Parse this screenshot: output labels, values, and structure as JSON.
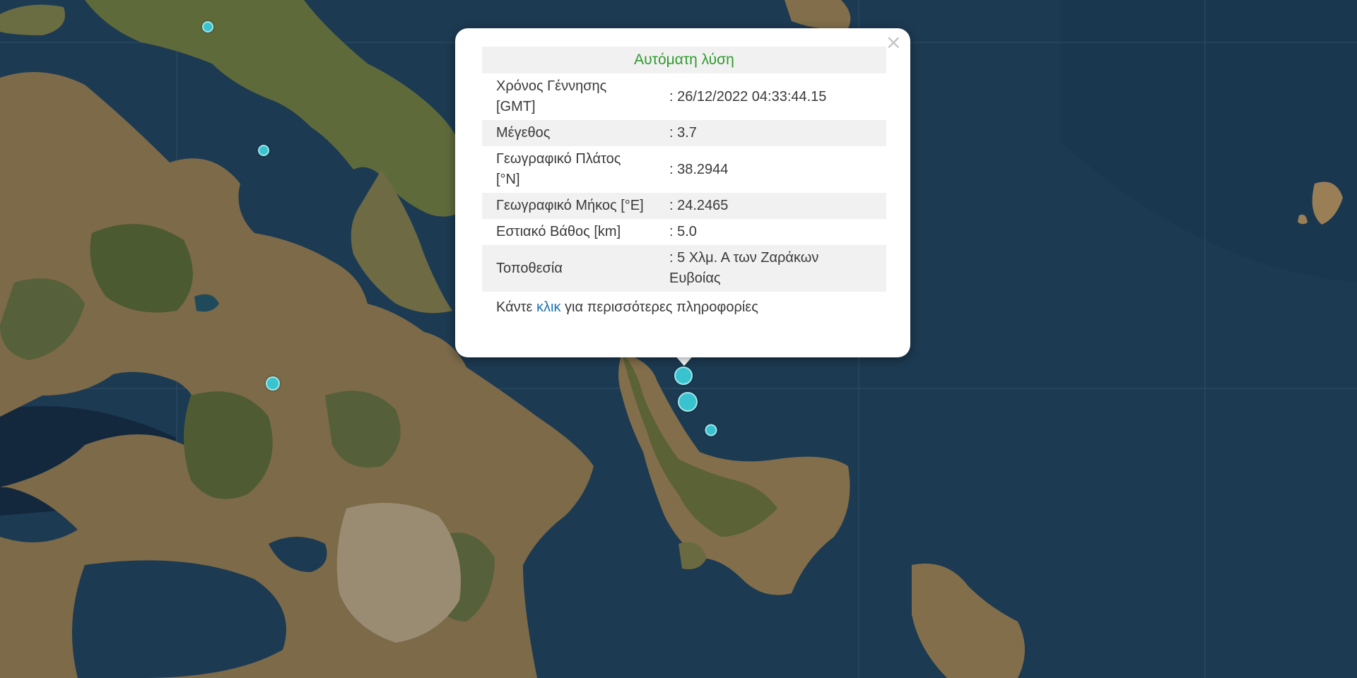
{
  "popup": {
    "title": "Αυτόματη λύση",
    "close_icon": "×",
    "rows": [
      {
        "label": "Χρόνος Γέννησης [GMT]",
        "value": ": 26/12/2022 04:33:44.15"
      },
      {
        "label": "Μέγεθος",
        "value": ": 3.7"
      },
      {
        "label": "Γεωγραφικό Πλάτος [°N]",
        "value": ": 38.2944"
      },
      {
        "label": "Γεωγραφικό Μήκος [°E]",
        "value": ": 24.2465"
      },
      {
        "label": "Εστιακό Βάθος [km]",
        "value": ": 5.0"
      },
      {
        "label": "Τοποθεσία",
        "value": ": 5 Χλμ. Α των Ζαράκων Ευβοίας"
      }
    ],
    "more": {
      "before": "Κάντε ",
      "link": "κλικ",
      "after": " για περισσότερες πληροφορίες"
    }
  },
  "colors": {
    "sea": "#1c3a52",
    "land": "#7a6a4a",
    "forest": "#4a5a30",
    "marker": "#39c3cf",
    "title_green": "#2f9a2f",
    "link_blue": "#1a73b5"
  },
  "map": {
    "layer": "satellite",
    "region": "Euboea / Attica, Greece"
  }
}
